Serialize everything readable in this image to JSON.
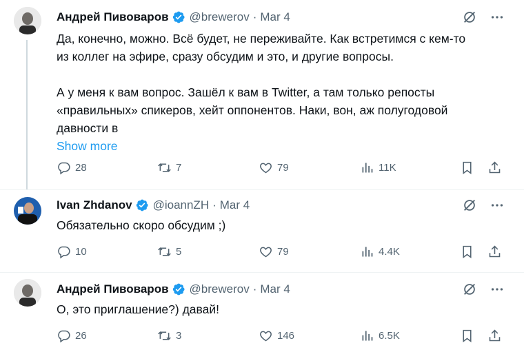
{
  "colors": {
    "accent": "#1d9bf0",
    "muted": "#536471",
    "text": "#0f1419"
  },
  "tweets": [
    {
      "name": "Андрей Пивоваров",
      "handle": "@brewerov",
      "separator": "·",
      "date": "Mar 4",
      "lines": [
        "Да, конечно, можно. Всё будет, не переживайте. Как встретимся с кем-то",
        "из коллег на эфире, сразу обсудим и это, и другие вопросы.",
        "",
        "А у меня к вам вопрос. Зашёл к вам в Twitter, а там только репосты",
        "«правильных» спикеров, хейт оппонентов. Наки, вон, аж полугодовой",
        "давности в"
      ],
      "show_more": "Show more",
      "replies": "28",
      "reposts": "7",
      "likes": "79",
      "views": "11K"
    },
    {
      "name": "Ivan Zhdanov",
      "handle": "@ioannZH",
      "separator": "·",
      "date": "Mar 4",
      "lines": [
        "Обязательно скоро обсудим ;)"
      ],
      "replies": "10",
      "reposts": "5",
      "likes": "79",
      "views": "4.4K"
    },
    {
      "name": "Андрей Пивоваров",
      "handle": "@brewerov",
      "separator": "·",
      "date": "Mar 4",
      "lines": [
        "О, это приглашение?) давай!"
      ],
      "replies": "26",
      "reposts": "3",
      "likes": "146",
      "views": "6.5K"
    }
  ]
}
